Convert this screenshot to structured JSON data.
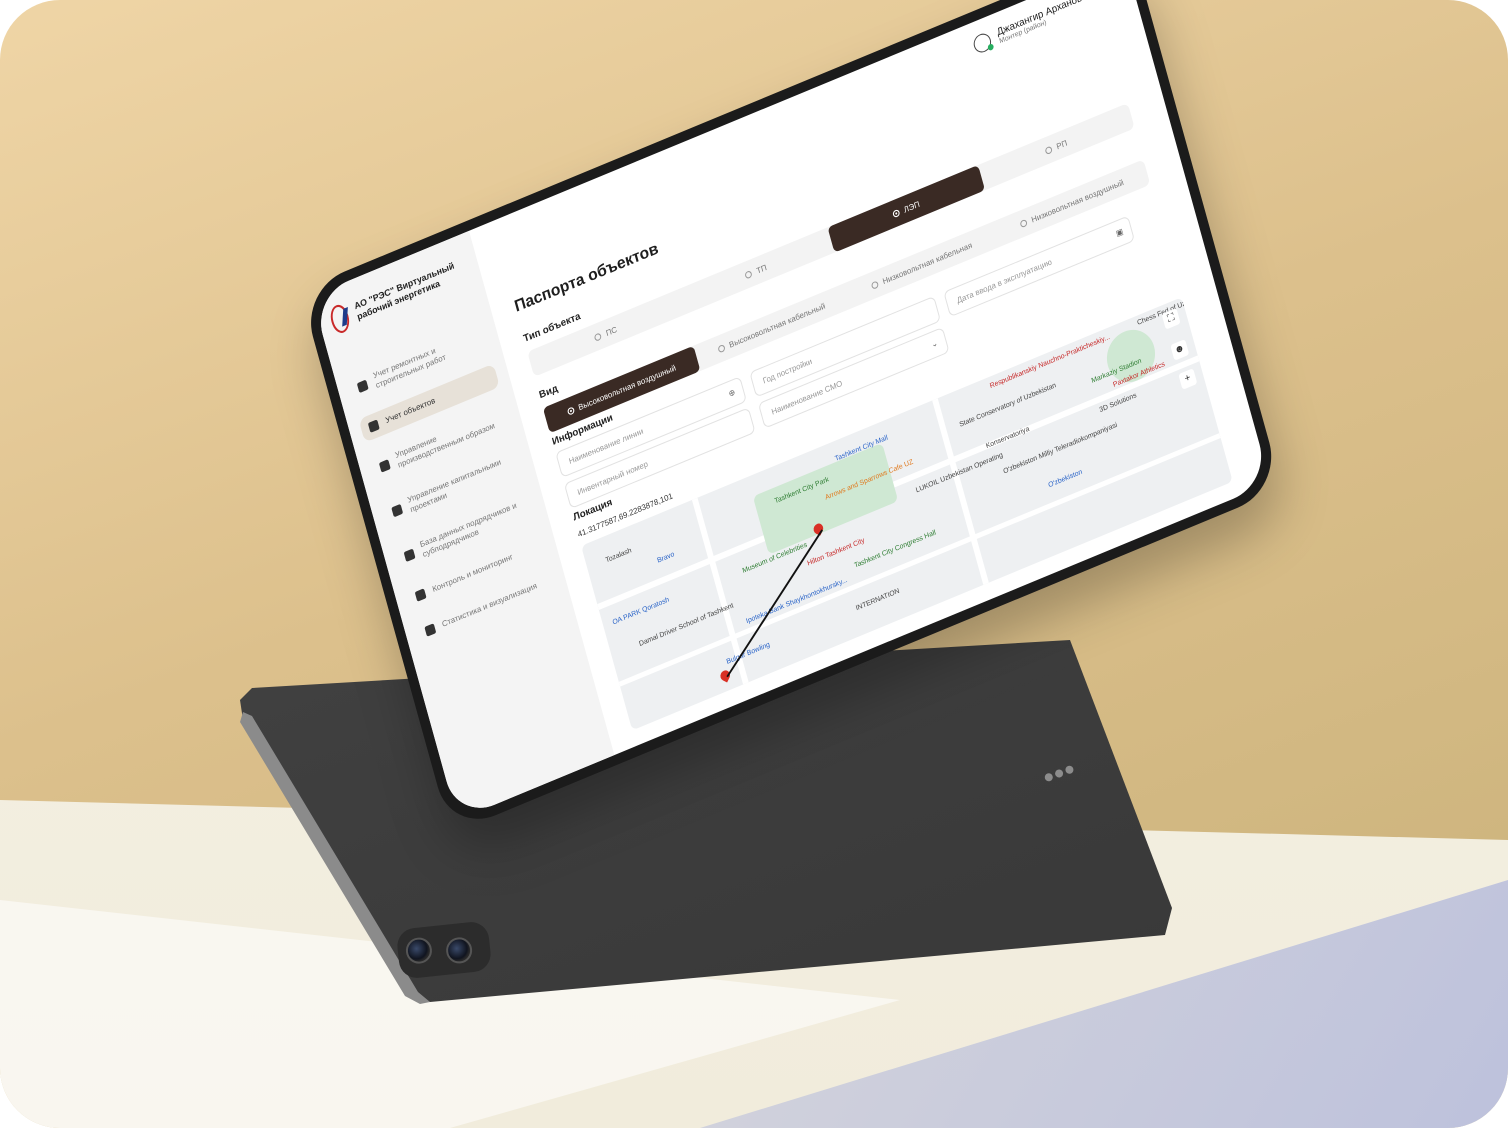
{
  "app": {
    "org_name": "АО \"РЭС\" Виртуальный рабочий энергетика"
  },
  "user": {
    "name": "Джахангир Арханов",
    "role": "Монтер (район)"
  },
  "sidebar": {
    "items": [
      {
        "label": "Учет ремонтных и строительных работ",
        "icon": "gear-icon",
        "active": false
      },
      {
        "label": "Учет объектов",
        "icon": "monitor-icon",
        "active": true
      },
      {
        "label": "Управление производственным образом",
        "icon": "clipboard-icon",
        "active": false
      },
      {
        "label": "Управление капитальными проектами",
        "icon": "folder-icon",
        "active": false
      },
      {
        "label": "База данных подрядчиков и субподрядчиков",
        "icon": "database-icon",
        "active": false
      },
      {
        "label": "Контроль и мониторинг",
        "icon": "chart-icon",
        "active": false
      },
      {
        "label": "Статистика и визуализация",
        "icon": "stats-icon",
        "active": false
      }
    ]
  },
  "main": {
    "title": "Паспорта объектов",
    "object_type": {
      "label": "Тип объекта",
      "options": [
        {
          "label": "ПС",
          "selected": false
        },
        {
          "label": "ТП",
          "selected": false
        },
        {
          "label": "ЛЭП",
          "selected": true
        },
        {
          "label": "РП",
          "selected": false
        }
      ]
    },
    "kind": {
      "label": "Вид",
      "options": [
        {
          "label": "Высоковольтная воздушный",
          "selected": true
        },
        {
          "label": "Высоковольтная кабельный",
          "selected": false
        },
        {
          "label": "Низковольтная кабельная",
          "selected": false
        },
        {
          "label": "Низковольтная воздушный",
          "selected": false
        }
      ]
    },
    "info": {
      "label": "Информации",
      "fields": {
        "line_name": "Наименование линии",
        "build_year": "Год постройки",
        "commission_date": "Дата ввода в эксплуатацию",
        "inventory_number": "Инвентарный номер",
        "smo_name": "Наименование СМО"
      }
    },
    "location": {
      "label": "Локация",
      "coords": "41.3177587,69.2283878,101"
    },
    "map": {
      "places": [
        {
          "name": "Tashkent City Park",
          "style": "green"
        },
        {
          "name": "Tashkent City Mall",
          "style": "blue"
        },
        {
          "name": "Arrows and Sparrows Cafe UZ",
          "style": "orange"
        },
        {
          "name": "Museum of Celebrities",
          "style": "green"
        },
        {
          "name": "Hilton Tashkent City",
          "style": "red"
        },
        {
          "name": "Tashkent City Congress Hall",
          "style": "green"
        },
        {
          "name": "State Conservatory of Uzbekistan",
          "style": "plain"
        },
        {
          "name": "LUKOIL Uzbekistan Operating",
          "style": "plain"
        },
        {
          "name": "O'zbekiston Milliy Teleradiokompaniyasi",
          "style": "plain"
        },
        {
          "name": "Respublikanskiy Nauchno-Prakticheskiy...",
          "style": "red"
        },
        {
          "name": "Markaziy Stadion",
          "style": "green"
        },
        {
          "name": "Paxtakor Athletics",
          "style": "red"
        },
        {
          "name": "3D Solutions",
          "style": "plain"
        },
        {
          "name": "Chess Fed of Uzbekistan",
          "style": "plain"
        },
        {
          "name": "Tozalash",
          "style": "plain"
        },
        {
          "name": "Bravo",
          "style": "blue"
        },
        {
          "name": "Damal Driver School of Tashkent",
          "style": "plain"
        },
        {
          "name": "Ipoteka Bank Shaykhontokhursky...",
          "style": "blue"
        },
        {
          "name": "Bulgar Bowling",
          "style": "blue"
        },
        {
          "name": "OA PARK Qoratosh",
          "style": "blue"
        },
        {
          "name": "O'zbekiston",
          "style": "blue"
        },
        {
          "name": "Konservatoriya",
          "style": "plain"
        },
        {
          "name": "INTERNATION",
          "style": "plain"
        }
      ]
    }
  }
}
